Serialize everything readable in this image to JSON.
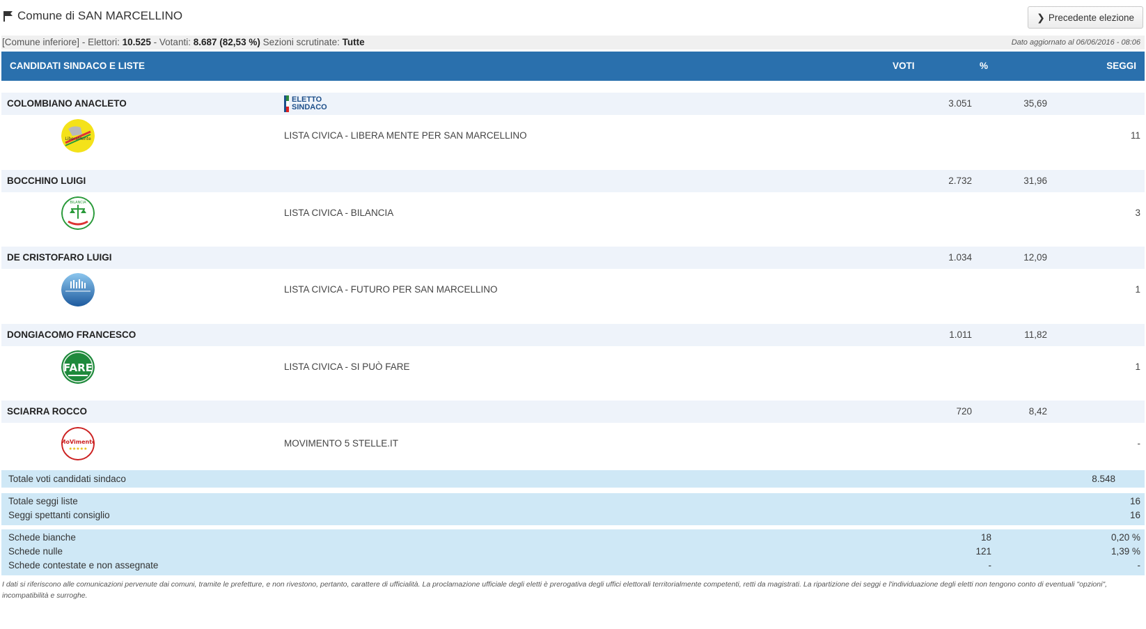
{
  "header": {
    "title": "Comune di SAN MARCELLINO",
    "prev_button": "Precedente elezione"
  },
  "info": {
    "type": "[Comune inferiore]",
    "elettori_label": "- Elettori:",
    "elettori": "10.525",
    "votanti_label": "- Votanti:",
    "votanti": "8.687",
    "votanti_pct": "(82,53 %)",
    "sezioni_label": "Sezioni scrutinate:",
    "sezioni": "Tutte",
    "updated": "Dato aggiornato al 06/06/2016 - 08:06"
  },
  "table_header": {
    "candidati": "CANDIDATI SINDACO E LISTE",
    "voti": "VOTI",
    "pct": "%",
    "seggi": "SEGGI"
  },
  "eletto": {
    "line1": "ELETTO",
    "line2": "SINDACO"
  },
  "candidates": [
    {
      "name": "COLOMBIANO ANACLETO",
      "voti": "3.051",
      "pct": "35,69",
      "list": "LISTA CIVICA - LIBERA MENTE PER SAN MARCELLINO",
      "seats": "11",
      "logo": "libera-mente-logo"
    },
    {
      "name": "BOCCHINO LUIGI",
      "voti": "2.732",
      "pct": "31,96",
      "list": "LISTA CIVICA - BILANCIA",
      "seats": "3",
      "logo": "bilancia-logo"
    },
    {
      "name": "DE CRISTOFARO LUIGI",
      "voti": "1.034",
      "pct": "12,09",
      "list": "LISTA CIVICA - FUTURO PER SAN MARCELLINO",
      "seats": "1",
      "logo": "futuro-logo"
    },
    {
      "name": "DONGIACOMO FRANCESCO",
      "voti": "1.011",
      "pct": "11,82",
      "list": "LISTA CIVICA - SI PUÒ FARE",
      "seats": "1",
      "logo": "si-puo-fare-logo"
    },
    {
      "name": "SCIARRA ROCCO",
      "voti": "720",
      "pct": "8,42",
      "list": "MOVIMENTO 5 STELLE.IT",
      "seats": "-",
      "logo": "movimento-5-stelle-logo"
    }
  ],
  "totals": {
    "voti_sindaco_label": "Totale voti candidati sindaco",
    "voti_sindaco": "8.548",
    "seggi_liste_label": "Totale seggi liste",
    "seggi_liste": "16",
    "seggi_consiglio_label": "Seggi spettanti consiglio",
    "seggi_consiglio": "16",
    "bianche_label": "Schede bianche",
    "bianche": "18",
    "bianche_pct": "0,20 %",
    "nulle_label": "Schede nulle",
    "nulle": "121",
    "nulle_pct": "1,39 %",
    "contestate_label": "Schede contestate e non assegnate",
    "contestate": "-",
    "contestate_pct": "-"
  },
  "footnote": "I dati si riferiscono alle comunicazioni pervenute dai comuni, tramite le prefetture, e non rivestono, pertanto, carattere di ufficialità. La proclamazione ufficiale degli eletti è prerogativa degli uffici elettorali territorialmente competenti, retti da magistrati. La ripartizione dei seggi e l'individuazione degli eletti non tengono conto di eventuali \"opzioni\", incompatibilità e surroghe.",
  "colors": {
    "header_blue": "#2a70ad",
    "row_tint": "#eef3fa",
    "totals_bg": "#cfe8f6"
  }
}
